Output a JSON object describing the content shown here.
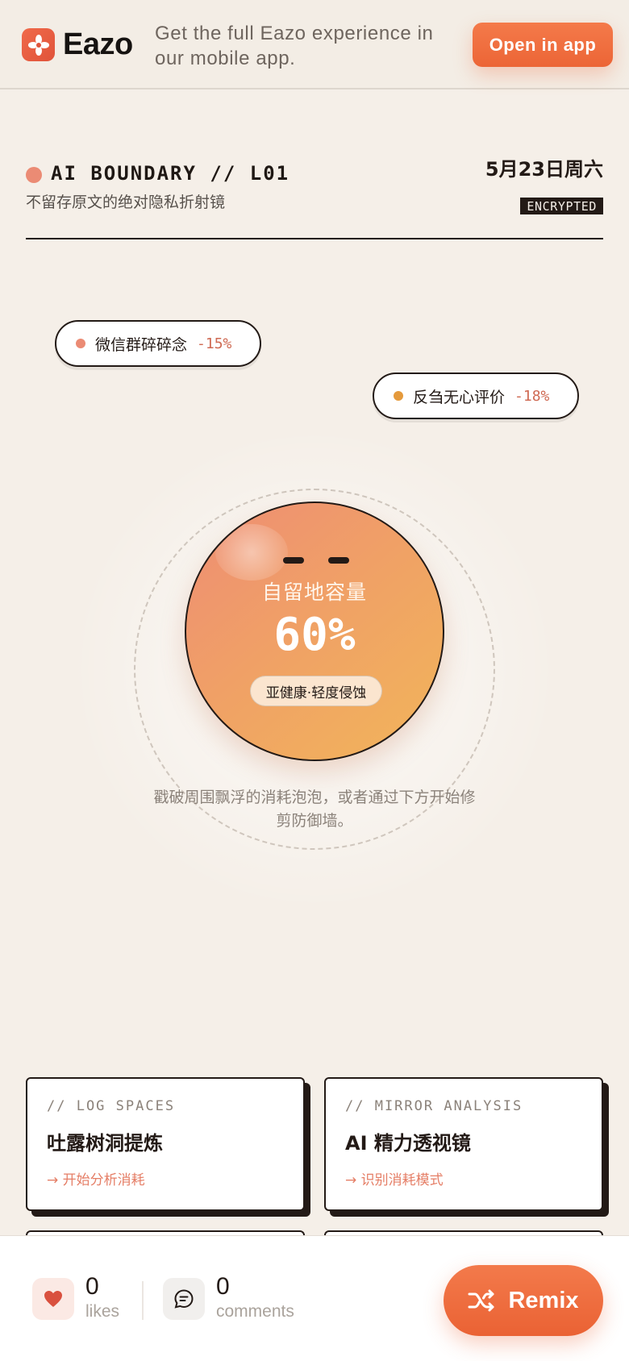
{
  "app_banner": {
    "brand_name": "Eazo",
    "message": "Get the full Eazo experience in our mobile app.",
    "open_button": "Open in app"
  },
  "header": {
    "title": "AI BOUNDARY // L01",
    "subtitle": "不留存原文的绝对隐私折射镜",
    "date": "5月23日周六",
    "badge": "ENCRYPTED"
  },
  "bubbles": [
    {
      "label": "微信群碎碎念",
      "value": "-15%",
      "dot_color": "#eb8b74"
    },
    {
      "label": "反刍无心评价",
      "value": "-18%",
      "dot_color": "#e59a3c"
    }
  ],
  "core": {
    "label": "自留地容量",
    "value": "60%",
    "capacity_percent": 60,
    "status": "亚健康·轻度侵蚀"
  },
  "hint": "戳破周围飘浮的消耗泡泡，或者通过下方开始修剪防御墙。",
  "cards": [
    {
      "kicker": "// LOG SPACES",
      "title": "吐露树洞提炼",
      "link": "→ 开始分析消耗"
    },
    {
      "kicker": "// MIRROR ANALYSIS",
      "title": "AI 精力透视镜",
      "link": "→ 识别消耗模式"
    }
  ],
  "bottom_bar": {
    "likes_count": "0",
    "likes_label": "likes",
    "comments_count": "0",
    "comments_label": "comments",
    "remix_label": "Remix",
    "icons": {
      "likes": "heart-icon",
      "comments": "comment-icon",
      "remix": "shuffle-icon"
    }
  },
  "colors": {
    "accent": "#ec6536",
    "background": "#f5efe8",
    "ink": "#231a16"
  }
}
